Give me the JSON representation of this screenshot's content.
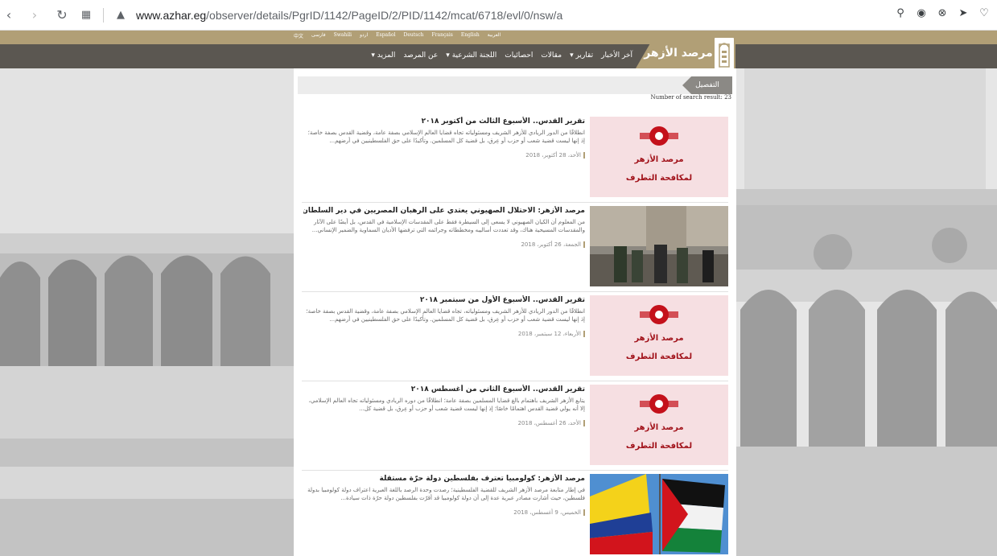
{
  "browser": {
    "url_host": "www.azhar.eg",
    "url_path": "/observer/details/PgrID/1142/PageID/2/PID/1142/mcat/6718/evl/0/nsw/a"
  },
  "languages": [
    "العربية",
    "English",
    "Français",
    "Deutsch",
    "Español",
    "اردو",
    "Swahili",
    "فارسی",
    "中文"
  ],
  "brand": {
    "name": "مرصد الأزهر"
  },
  "menu": [
    {
      "label": "آخر الأخبار",
      "has_dropdown": false
    },
    {
      "label": "تقارير",
      "has_dropdown": true
    },
    {
      "label": "مقالات",
      "has_dropdown": false
    },
    {
      "label": "احصائيات",
      "has_dropdown": false
    },
    {
      "label": "اللجنة الشرعية",
      "has_dropdown": true
    },
    {
      "label": "عن المرصد",
      "has_dropdown": false
    },
    {
      "label": "المزيد",
      "has_dropdown": true
    }
  ],
  "breadcrumb": {
    "label": "التفصيل"
  },
  "results_count_text": "Number of search result: 23",
  "placeholder_card": {
    "line1": "مرصد الأزهر",
    "line2": "لمكافحة التطرف"
  },
  "items": [
    {
      "title": "تقرير القدس.. الأسبوع الثالث من أكتوبر ٢٠١٨",
      "snippet": "انطلاقًا من الدور الريادي للأزهر الشريف ومسئولياته تجاه قضايا العالم الإسلامي بصفة عامة، وقضية القدس بصفة خاصة؛ إذ إنها ليست قضية شعب أو حزب أو عِرق، بل قضية كل المسلمين. وتأكيدًا على حق الفلسطينيين في أرضهم...",
      "date": "الأحد، 28 أكتوبر، 2018",
      "thumb": "placeholder"
    },
    {
      "title": "مرصد الأزهر: الاحتلال الصهيوني يعتدي على الرهبان المصريين في دير السلطان بالقدس المحتلة",
      "snippet": "من المعلوم أن الكيان الصهيوني لا يسعى إلى السيطرة فقط على المقدسات الإسلامية في القدس، بل أيضًا على الآثار والمقدسات المسيحية هناك، وقد تعددت أساليبه ومخططاته وجرائمه التي ترفضها الأديان السماوية والضمير الإنساني...",
      "date": "الجمعة، 26 أكتوبر، 2018",
      "thumb": "photo"
    },
    {
      "title": "تقرير القدس.. الأسبوع الأول من سبتمبر ٢٠١٨",
      "snippet": "انطلاقًا من الدور الريادي للأزهر الشريف ومسئولياته، تجاه قضايا العالم الإسلامي بصفة عامة، وقضية القدس بصفة خاصة؛ إذ إنها ليست قضية شعب أو حزب أو عِرق، بل قضية كل المسلمين. وتأكيدًا على حق الفلسطينيين في أرضهم...",
      "date": "الأربعاء، 12 سبتمبر، 2018",
      "thumb": "placeholder"
    },
    {
      "title": "تقرير القدس.. الأسبوع الثاني من أغسطس ٢٠١٨",
      "snippet": "يتابع الأزهر الشريف باهتمام بالغ قضايا المسلمين بصفة عامة؛ انطلاقًا من دوره الريادي ومسئولياته تجاه العالم الإسلامي، إلا أنه يولي قضية القدس اهتمامًا خاصًا؛ إذ إنها ليست قضية شعب أو حزب أو عِرق، بل قضية كل...",
      "date": "الأحد، 26 أغسطس، 2018",
      "thumb": "placeholder"
    },
    {
      "title": "مرصد الأزهر: كولومبيا تعترف بفلسطين دولة حرّة مستقلة",
      "snippet": "في إطار متابعة مرصد الأزهر الشريف للقضية الفلسطينية؛ رصدت وحدة الرصد باللغة العبرية اعتراف دولة كولومبيا بدولة فلسطين، حيث أشارت مصادر عبرية عدة إلى أن دولة كولومبيا قد أقرّت بفلسطين دولة حرّة ذات سيادة...",
      "date": "الخميس، 9 أغسطس، 2018",
      "thumb": "flags"
    }
  ]
}
